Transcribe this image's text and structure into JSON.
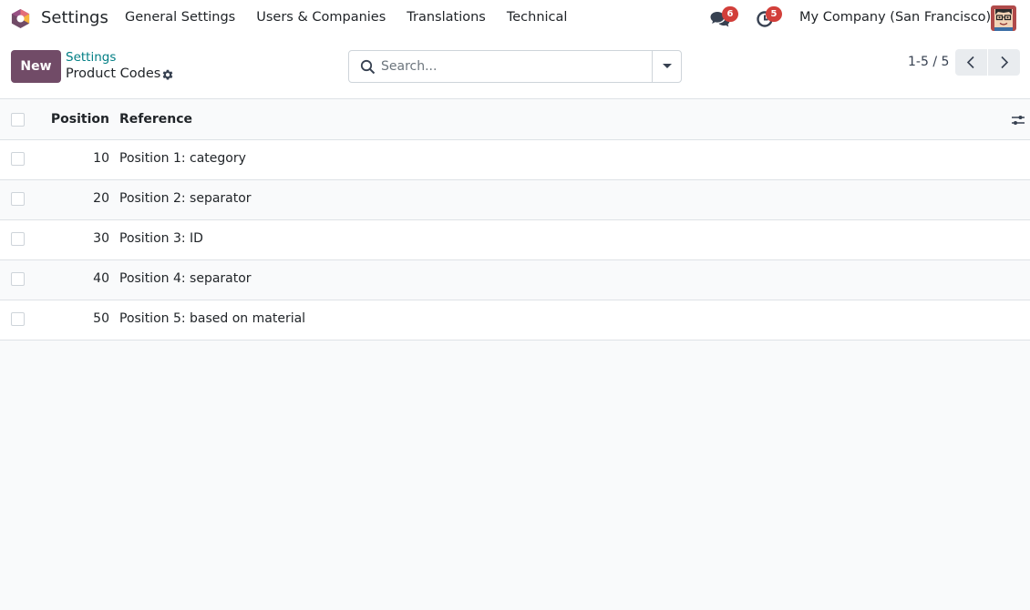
{
  "navbar": {
    "app_name": "Settings",
    "menu": [
      "General Settings",
      "Users & Companies",
      "Translations",
      "Technical"
    ],
    "messages_count": "6",
    "activities_count": "5",
    "company": "My Company (San Francisco)"
  },
  "control_panel": {
    "new_label": "New",
    "breadcrumb_parent": "Settings",
    "breadcrumb_current": "Product Codes",
    "search_placeholder": "Search...",
    "pager": "1-5 / 5"
  },
  "list": {
    "columns": [
      "Position",
      "Reference"
    ],
    "rows": [
      {
        "position": "10",
        "reference": "Position 1: category"
      },
      {
        "position": "20",
        "reference": "Position 2: separator"
      },
      {
        "position": "30",
        "reference": "Position 3: ID"
      },
      {
        "position": "40",
        "reference": "Position 4: separator"
      },
      {
        "position": "50",
        "reference": "Position 5: based on material"
      }
    ]
  },
  "colors": {
    "brand": "#714b67",
    "link": "#017e84",
    "badge": "#d23f3a"
  },
  "icons": [
    "odoo-logo-icon",
    "chat-icon",
    "clock-icon",
    "user-avatar-icon",
    "gear-icon",
    "search-icon",
    "caret-down-icon",
    "chevron-left-icon",
    "chevron-right-icon",
    "sliders-icon"
  ]
}
